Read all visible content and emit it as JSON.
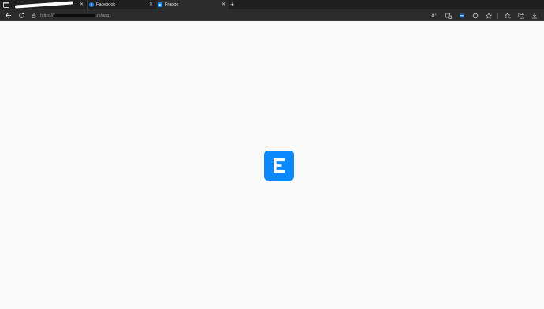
{
  "tabs": [
    {
      "title": "",
      "active": false
    },
    {
      "title": "Facebook",
      "favicon": "f",
      "favicon_color": "#1877f2",
      "active": false
    },
    {
      "title": "Frappe",
      "favicon": "F",
      "favicon_color": "#0a89ff",
      "active": true
    }
  ],
  "toolbar": {
    "url_prefix": "https://",
    "url_suffix": ".m/app"
  },
  "colors": {
    "tab_strip": "#1f1f1f",
    "toolbar": "#2b2b2b",
    "page_background": "#fafafa",
    "brand": "#0a89ff"
  },
  "icons": {
    "window_menu": "window-menu-icon",
    "new_tab": "plus-icon",
    "back": "back-arrow-icon",
    "reload": "reload-icon",
    "lock": "lock-icon",
    "read_aloud": "read-aloud-icon",
    "app_available": "app-available-icon",
    "extension": "extension-icon",
    "refresh_page": "refresh-page-icon",
    "favorite": "star-icon",
    "favorites": "favorites-icon",
    "collections": "collections-icon",
    "downloads": "download-icon",
    "app_logo": "frappe-logo-icon"
  }
}
